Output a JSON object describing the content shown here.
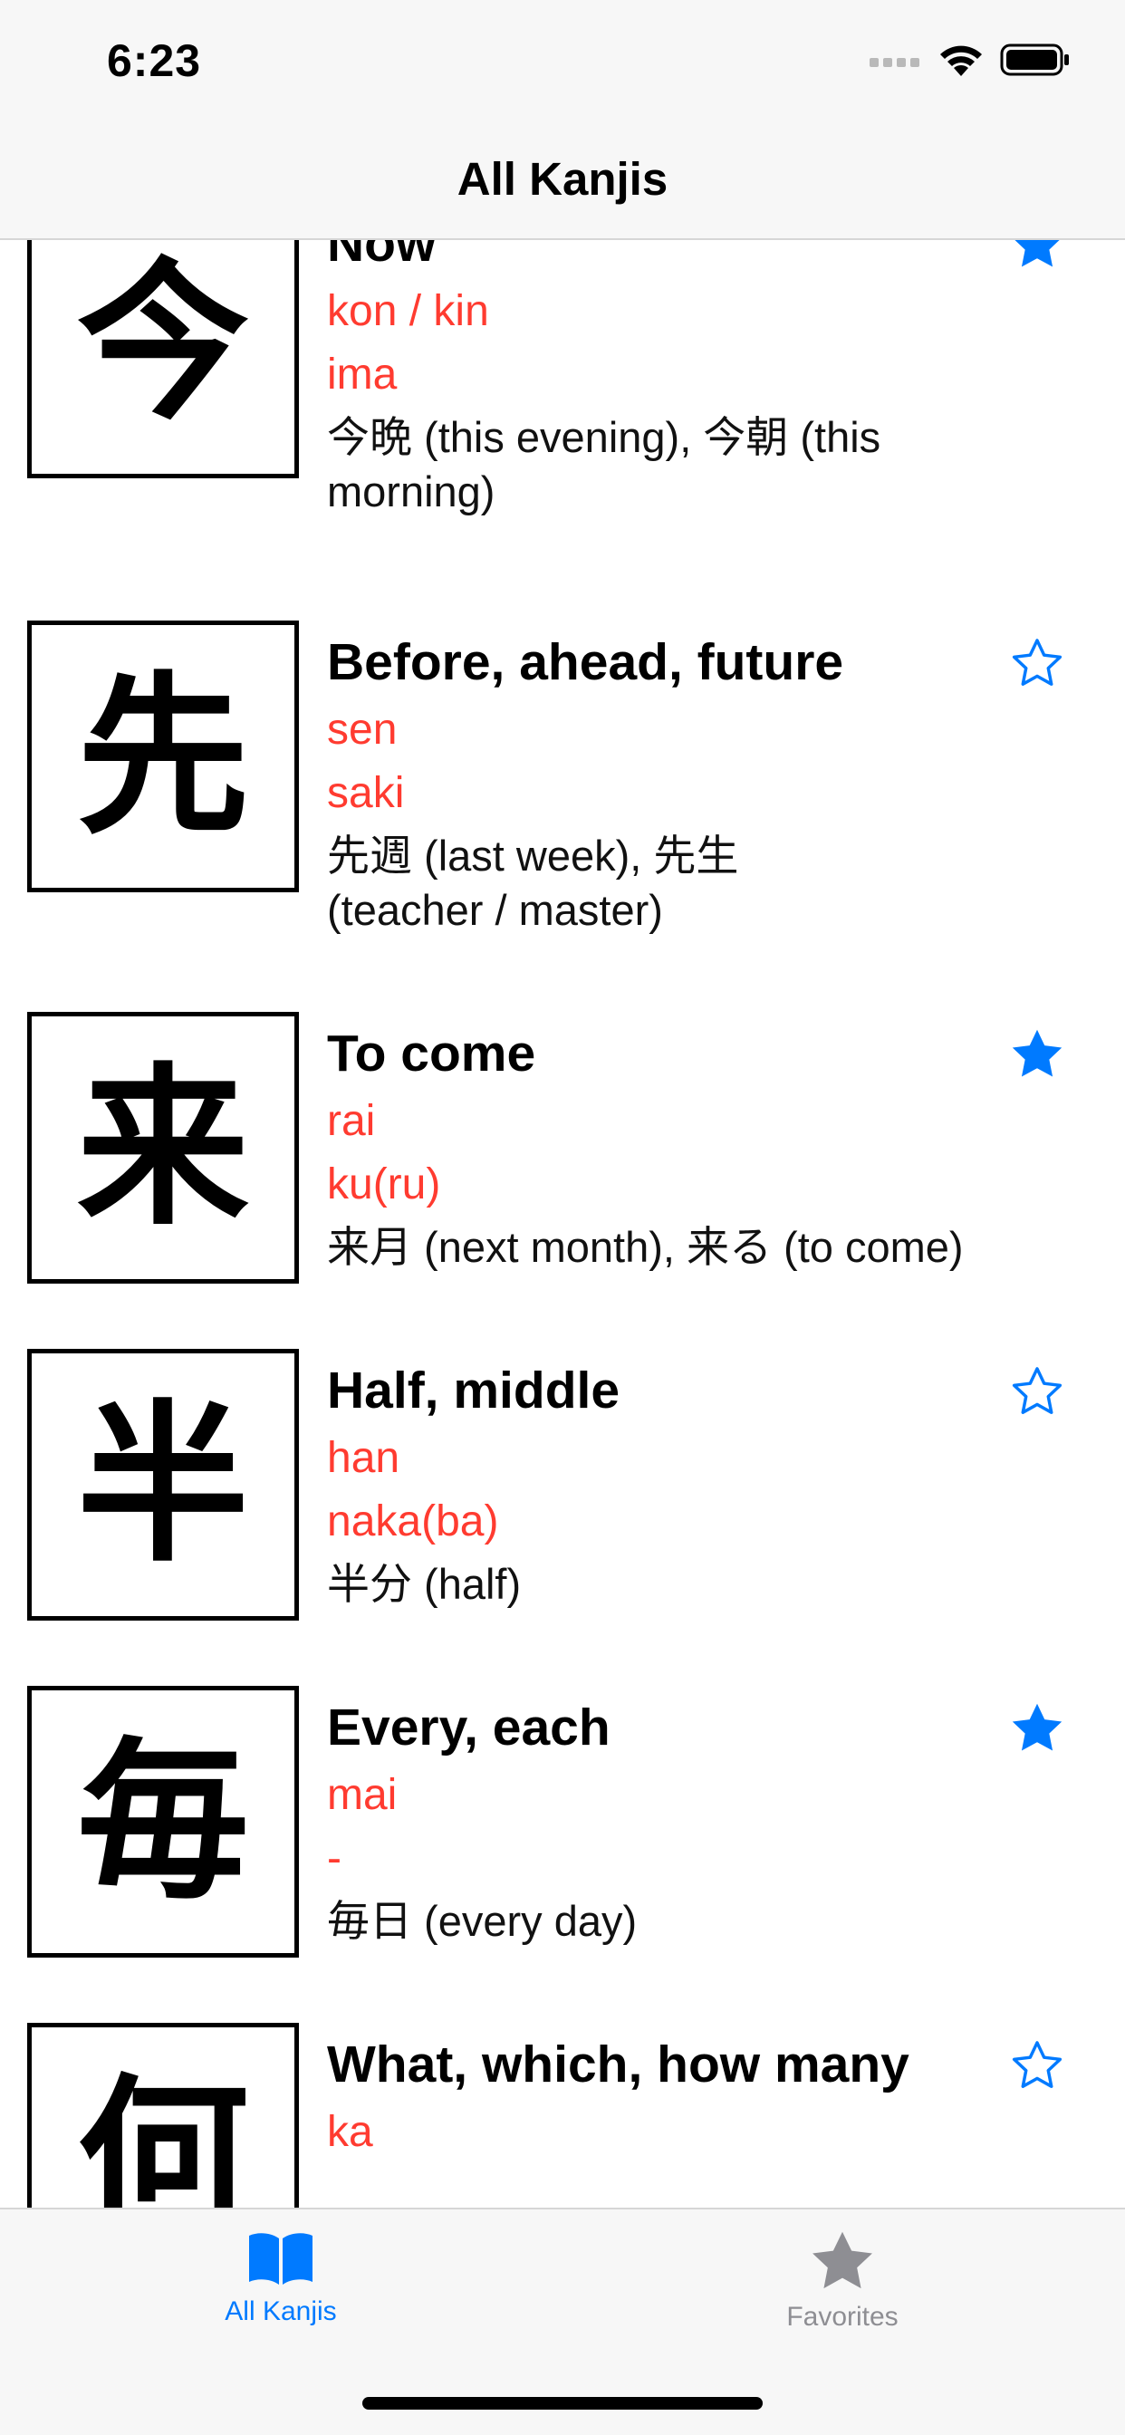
{
  "status_bar": {
    "time": "6:23"
  },
  "nav": {
    "title": "All Kanjis"
  },
  "colors": {
    "accent": "#007aff",
    "reading": "#ff3b30",
    "inactive": "#8e8e93"
  },
  "kanjis": [
    {
      "kanji": "今",
      "meaning": "Now",
      "onyomi": "kon / kin",
      "kunyomi": "ima",
      "examples": "今晩  (this evening), 今朝 (this morning)",
      "favorite": true
    },
    {
      "kanji": "先",
      "meaning": "Before, ahead, future",
      "onyomi": "sen",
      "kunyomi": "saki",
      "examples": "先週 (last week), 先生 (teacher / master)",
      "favorite": false
    },
    {
      "kanji": "来",
      "meaning": "To come",
      "onyomi": "rai",
      "kunyomi": "ku(ru)",
      "examples": "来月 (next month), 来る (to come)",
      "favorite": true
    },
    {
      "kanji": "半",
      "meaning": "Half, middle",
      "onyomi": "han",
      "kunyomi": "naka(ba)",
      "examples": "半分 (half)",
      "favorite": false
    },
    {
      "kanji": "毎",
      "meaning": "Every, each",
      "onyomi": "mai",
      "kunyomi": "-",
      "examples": "毎日 (every day)",
      "favorite": true
    },
    {
      "kanji": "何",
      "meaning": "What, which, how many",
      "onyomi": "ka",
      "kunyomi": "",
      "examples": "",
      "favorite": false
    }
  ],
  "tabs": [
    {
      "label": "All Kanjis",
      "icon": "book-icon",
      "selected": true
    },
    {
      "label": "Favorites",
      "icon": "star-icon",
      "selected": false
    }
  ]
}
